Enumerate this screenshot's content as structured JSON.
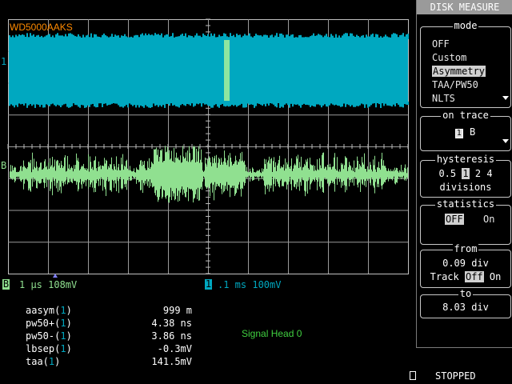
{
  "trace_label": "WD5000AAKS",
  "channels": {
    "ch1_marker": "1",
    "chB_marker": "B",
    "chB_scale": "1 μs 108mV",
    "ch1_scale": ".1 ms 100mV"
  },
  "annotation": "Signal Head 0",
  "measurements": [
    {
      "label": "aasym(1)",
      "value": "999 m"
    },
    {
      "label": "pw50+(1)",
      "value": "4.38 ns"
    },
    {
      "label": "pw50-(1)",
      "value": "3.86 ns"
    },
    {
      "label": "lbsep(1)",
      "value": "-0.3mV"
    },
    {
      "label": "taa(1)",
      "value": "141.5mV"
    }
  ],
  "status": "STOPPED",
  "menu": {
    "title": "DISK MEASURE",
    "mode": {
      "title": "mode",
      "options": [
        "OFF",
        "Custom",
        "Asymmetry",
        "TAA/PW50",
        "NLTS"
      ],
      "selected": "Asymmetry"
    },
    "on_trace": {
      "title": "on trace",
      "ch1": "1",
      "chB": "B"
    },
    "hysteresis": {
      "title": "hysteresis",
      "values": [
        "0.5",
        "1",
        "2",
        "4"
      ],
      "selected": "1",
      "unit": "divisions"
    },
    "statistics": {
      "title": "statistics",
      "off": "OFF",
      "on": "On",
      "selected": "OFF"
    },
    "from": {
      "title": "from",
      "value": "0.09 div",
      "track_label": "Track",
      "off": "Off",
      "on": "On",
      "selected": "Off"
    },
    "to": {
      "title": "to",
      "value": "8.03 div"
    }
  },
  "colors": {
    "ch1": "#00a8c0",
    "chB": "#90e090",
    "highlight": "#8ee6a0",
    "trace_label": "#ff8a00",
    "annotation": "#40d040",
    "grid": "#c0c0c0"
  }
}
